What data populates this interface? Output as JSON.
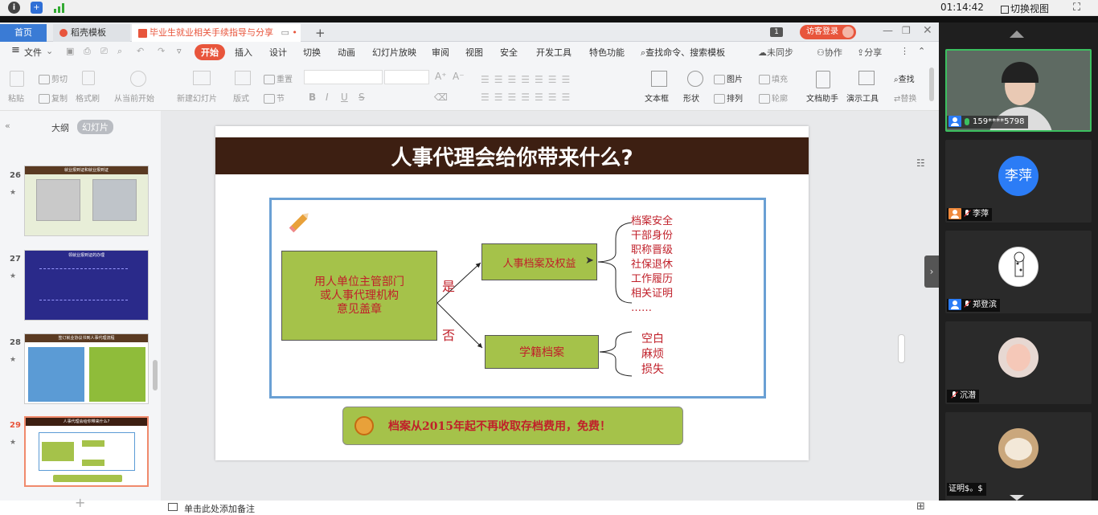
{
  "system_bar": {
    "time": "01:14:42",
    "switch_view": "切换视图"
  },
  "tabs": {
    "home": "首页",
    "template": "稻壳模板",
    "document": "毕业生就业相关手续指导与分享",
    "badge": "1",
    "login": "访客登录"
  },
  "menu": {
    "file": "文件",
    "items": [
      "开始",
      "插入",
      "设计",
      "切换",
      "动画",
      "幻灯片放映",
      "审阅",
      "视图",
      "安全",
      "开发工具",
      "特色功能"
    ],
    "search": "查找命令、搜索模板",
    "sync": "未同步",
    "collab": "协作",
    "share": "分享"
  },
  "ribbon": {
    "paste": "粘贴",
    "cut": "剪切",
    "copy": "复制",
    "format_painter": "格式刷",
    "from_current": "从当前开始",
    "new_slide": "新建幻灯片",
    "layout": "版式",
    "section": "节",
    "reset": "重置",
    "textbox": "文本框",
    "shape": "形状",
    "picture": "图片",
    "fill": "填充",
    "arrange": "排列",
    "outline": "轮廓",
    "doc_helper": "文档助手",
    "present_tool": "演示工具",
    "find": "查找",
    "replace": "替换"
  },
  "left_panel": {
    "outline_tab": "大纲",
    "slides_tab": "幻灯片",
    "slides": [
      {
        "num": "26",
        "title": "就业报到证和就业报到证"
      },
      {
        "num": "27",
        "title": "领就业报到证的办理"
      },
      {
        "num": "28",
        "title": "签订就业协议书到人事代理流程"
      },
      {
        "num": "29",
        "title": "人事代理会给你带来什么?"
      }
    ],
    "add": "+"
  },
  "notes_placeholder": "单击此处添加备注",
  "slide": {
    "title": "人事代理会给你带来什么?",
    "source_box": "用人单位主管部门\n或人事代理机构\n意见盖章",
    "yes": "是",
    "no": "否",
    "box_personnel": "人事档案及权益",
    "box_academic": "学籍档案",
    "personnel_items": [
      "档案安全",
      "干部身份",
      "职称晋级",
      "社保退休",
      "工作履历",
      "相关证明",
      "……"
    ],
    "academic_items": [
      "空白",
      "麻烦",
      "损失"
    ],
    "banner": "档案从2015年起不再收取存档费用，免费！"
  },
  "video": {
    "participants": [
      {
        "name": "159****5798",
        "self": true
      },
      {
        "name": "李萍",
        "avatar_text": "李萍"
      },
      {
        "name": "郑登滨"
      },
      {
        "name": "沉潜"
      },
      {
        "name": "证明$。$"
      }
    ]
  },
  "colors": {
    "accent": "#e8553c",
    "slide_title_bg": "#3d1f12",
    "green": "#a5c24a",
    "frame": "#5b9bd5",
    "red_text": "#c0202a"
  }
}
